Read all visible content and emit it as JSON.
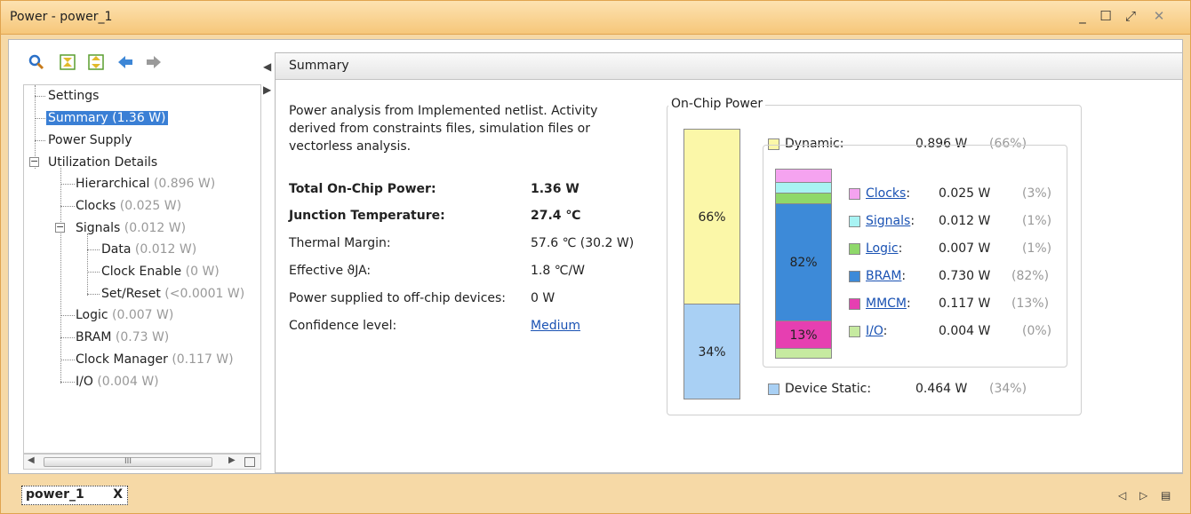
{
  "window": {
    "title": "Power - power_1",
    "minimize": "_",
    "maximize": "☐",
    "restore": "⤢",
    "close": "✕"
  },
  "toolbar": {
    "icons": [
      "search-icon",
      "collapse-all-icon",
      "expand-all-icon",
      "back-arrow-icon",
      "forward-arrow-icon"
    ]
  },
  "tree": {
    "settings": "Settings",
    "summary": "Summary (1.36 W)",
    "power_supply": "Power Supply",
    "utilization": "Utilization Details",
    "hierarchical": {
      "label": "Hierarchical",
      "value": "(0.896 W)"
    },
    "clocks": {
      "label": "Clocks",
      "value": "(0.025 W)"
    },
    "signals": {
      "label": "Signals",
      "value": "(0.012 W)"
    },
    "data": {
      "label": "Data",
      "value": "(0.012 W)"
    },
    "clock_enable": {
      "label": "Clock Enable",
      "value": "(0 W)"
    },
    "set_reset": {
      "label": "Set/Reset",
      "value": "(<0.0001 W)"
    },
    "logic": {
      "label": "Logic",
      "value": "(0.007 W)"
    },
    "bram": {
      "label": "BRAM",
      "value": "(0.73 W)"
    },
    "clock_manager": {
      "label": "Clock Manager",
      "value": "(0.117 W)"
    },
    "io": {
      "label": "I/O",
      "value": "(0.004 W)"
    }
  },
  "scrollbar": {
    "grip": "III"
  },
  "summary": {
    "header": "Summary",
    "description": "Power analysis from Implemented netlist. Activity derived from constraints files, simulation files or vectorless analysis.",
    "rows": {
      "total_label": "Total On-Chip Power:",
      "total_value": "1.36 W",
      "junction_label": "Junction Temperature:",
      "junction_value": "27.4 ℃",
      "thermal_label": "Thermal Margin:",
      "thermal_value": "57.6 ℃ (30.2 W)",
      "theta_label": "Effective ϑJA:",
      "theta_value": "1.8 ℃/W",
      "offchip_label": "Power supplied to off-chip devices:",
      "offchip_value": "0 W",
      "confidence_label": "Confidence level:",
      "confidence_value": "Medium"
    }
  },
  "on_chip": {
    "title": "On-Chip Power",
    "dynamic": {
      "label": "Dynamic:",
      "value": "0.896 W",
      "pct": "(66%)",
      "bar_label": "66%"
    },
    "static": {
      "label": "Device Static:",
      "value": "0.464 W",
      "pct": "(34%)",
      "bar_label": "34%"
    },
    "inner_bar_labels": {
      "bram": "82%",
      "mmcm": "13%"
    },
    "items": {
      "clocks": {
        "label": "Clocks",
        "value": "0.025 W",
        "pct": "(3%)",
        "color": "#f5a3f0"
      },
      "signals": {
        "label": "Signals",
        "value": "0.012 W",
        "pct": "(1%)",
        "color": "#a8f3f3"
      },
      "logic": {
        "label": "Logic",
        "value": "0.007 W",
        "pct": "(1%)",
        "color": "#8fd86a"
      },
      "bram": {
        "label": "BRAM",
        "value": "0.730 W",
        "pct": "(82%)",
        "color": "#3d8ad8"
      },
      "mmcm": {
        "label": "MMCM",
        "value": "0.117 W",
        "pct": "(13%)",
        "color": "#e63fb1"
      },
      "io": {
        "label": "I/O",
        "value": "0.004 W",
        "pct": "(0%)",
        "color": "#c6eaa0"
      }
    },
    "colors": {
      "dynamic": "#fbf7a8",
      "static": "#a9d0f4"
    },
    "colon": ":"
  },
  "bottom": {
    "tab": "power_1",
    "tab_close": "X",
    "nav_prev": "◁",
    "nav_next": "▷",
    "nav_menu": "▤"
  }
}
